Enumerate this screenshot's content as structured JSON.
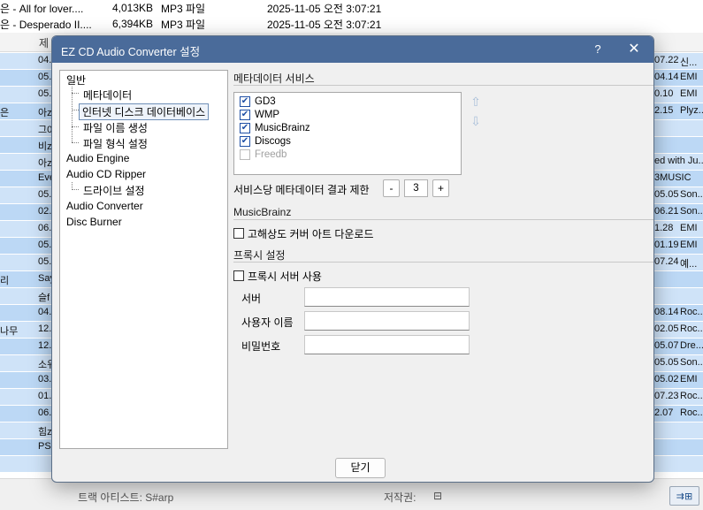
{
  "background": {
    "top_rows": [
      {
        "name": "은 - All for lover....",
        "size": "4,013KB",
        "type": "MP3 파일",
        "date": "2025-11-05 오전 3:07:21"
      },
      {
        "name": "은 - Desperado II....",
        "size": "6,394KB",
        "type": "MP3 파일",
        "date": "2025-11-05 오전 3:07:21"
      }
    ],
    "header_col": "제",
    "rows": [
      {
        "a": "",
        "b": "04.",
        "c": "07.22",
        "d": "신..."
      },
      {
        "a": "",
        "b": "05.",
        "c": "04.14",
        "d": "EMI"
      },
      {
        "a": "",
        "b": "05.",
        "c": "0.10",
        "d": "EMI"
      },
      {
        "a": "은",
        "b": "아z",
        "c": "2.15",
        "d": "Plyz..."
      },
      {
        "a": "",
        "b": "그0",
        "c": "",
        "d": ""
      },
      {
        "a": "",
        "b": "비z",
        "c": "",
        "d": ""
      },
      {
        "a": "",
        "b": "아z",
        "c": "ed with Ju...",
        "d": ""
      },
      {
        "a": "",
        "b": "Eve",
        "c": "3MUSIC",
        "d": ""
      },
      {
        "a": "",
        "b": "05.",
        "c": "05.05",
        "d": "Son..."
      },
      {
        "a": "",
        "b": "02.",
        "c": "06.21",
        "d": "Son..."
      },
      {
        "a": "",
        "b": "06.",
        "c": "1.28",
        "d": "EMI"
      },
      {
        "a": "",
        "b": "05.",
        "c": "01.19",
        "d": "EMI"
      },
      {
        "a": "",
        "b": "05.",
        "c": "07.24",
        "d": "예..."
      },
      {
        "a": "리",
        "b": "Say",
        "c": "",
        "d": ""
      },
      {
        "a": "",
        "b": "슬f",
        "c": "",
        "d": ""
      },
      {
        "a": "",
        "b": "04.",
        "c": "08.14",
        "d": "Roc..."
      },
      {
        "a": "나무",
        "b": "12.",
        "c": "02.05",
        "d": "Roc..."
      },
      {
        "a": "",
        "b": "12.",
        "c": "05.07",
        "d": "Dre..."
      },
      {
        "a": "",
        "b": "소워",
        "c": "05.05",
        "d": "Son..."
      },
      {
        "a": "",
        "b": "03.",
        "c": "05.02",
        "d": "EMI"
      },
      {
        "a": "",
        "b": "01.",
        "c": "07.23",
        "d": "Roc..."
      },
      {
        "a": "",
        "b": "06.",
        "c": "2.07",
        "d": "Roc..."
      },
      {
        "a": "",
        "b": "힘z",
        "c": "",
        "d": ""
      },
      {
        "a": "",
        "b": "PS.",
        "c": "",
        "d": ""
      },
      {
        "a": "",
        "b": "",
        "c": "",
        "d": ""
      }
    ],
    "status_artist": "트랙 아티스트: S#arp",
    "status_copyright": "저작권:",
    "status_copyright_icon": "⊟"
  },
  "dialog": {
    "title": "EZ CD Audio Converter 설정",
    "help": "?",
    "close_glyph": "✕",
    "tree": [
      {
        "label": "일반",
        "level": 0
      },
      {
        "label": "메타데이터",
        "level": 1
      },
      {
        "label": "인터넷 디스크 데이터베이스",
        "level": 1,
        "selected": true
      },
      {
        "label": "파일 이름 생성",
        "level": 1
      },
      {
        "label": "파일 형식 설정",
        "level": 1
      },
      {
        "label": "Audio Engine",
        "level": 0
      },
      {
        "label": "Audio CD Ripper",
        "level": 0
      },
      {
        "label": "드라이브 설정",
        "level": 1
      },
      {
        "label": "Audio Converter",
        "level": 0
      },
      {
        "label": "Disc Burner",
        "level": 0
      }
    ],
    "metadata_services": {
      "title": "메타데이터 서비스",
      "items": [
        {
          "label": "GD3",
          "checked": true,
          "enabled": true
        },
        {
          "label": "WMP",
          "checked": true,
          "enabled": true
        },
        {
          "label": "MusicBrainz",
          "checked": true,
          "enabled": true
        },
        {
          "label": "Discogs",
          "checked": true,
          "enabled": true
        },
        {
          "label": "Freedb",
          "checked": false,
          "enabled": false
        }
      ],
      "up_glyph": "⇧",
      "down_glyph": "⇩"
    },
    "limit": {
      "label": "서비스당 메타데이터 결과 제한",
      "minus": "-",
      "value": "3",
      "plus": "+"
    },
    "musicbrainz": {
      "title": "MusicBrainz",
      "hires_cover": {
        "label": "고해상도 커버 아트 다운로드",
        "checked": false
      }
    },
    "proxy": {
      "title": "프록시 설정",
      "use_proxy": {
        "label": "프록시 서버 사용",
        "checked": false
      },
      "server_label": "서버",
      "server_value": "",
      "user_label": "사용자 이름",
      "user_value": "",
      "password_label": "비밀번호",
      "password_value": ""
    },
    "close_button": "닫기"
  },
  "colors": {
    "row_blue": "#cfe3f8",
    "row_blue_alt": "#bcd8f5",
    "titlebar": "#4a6b9a",
    "check_blue": "#1e4fa5"
  }
}
